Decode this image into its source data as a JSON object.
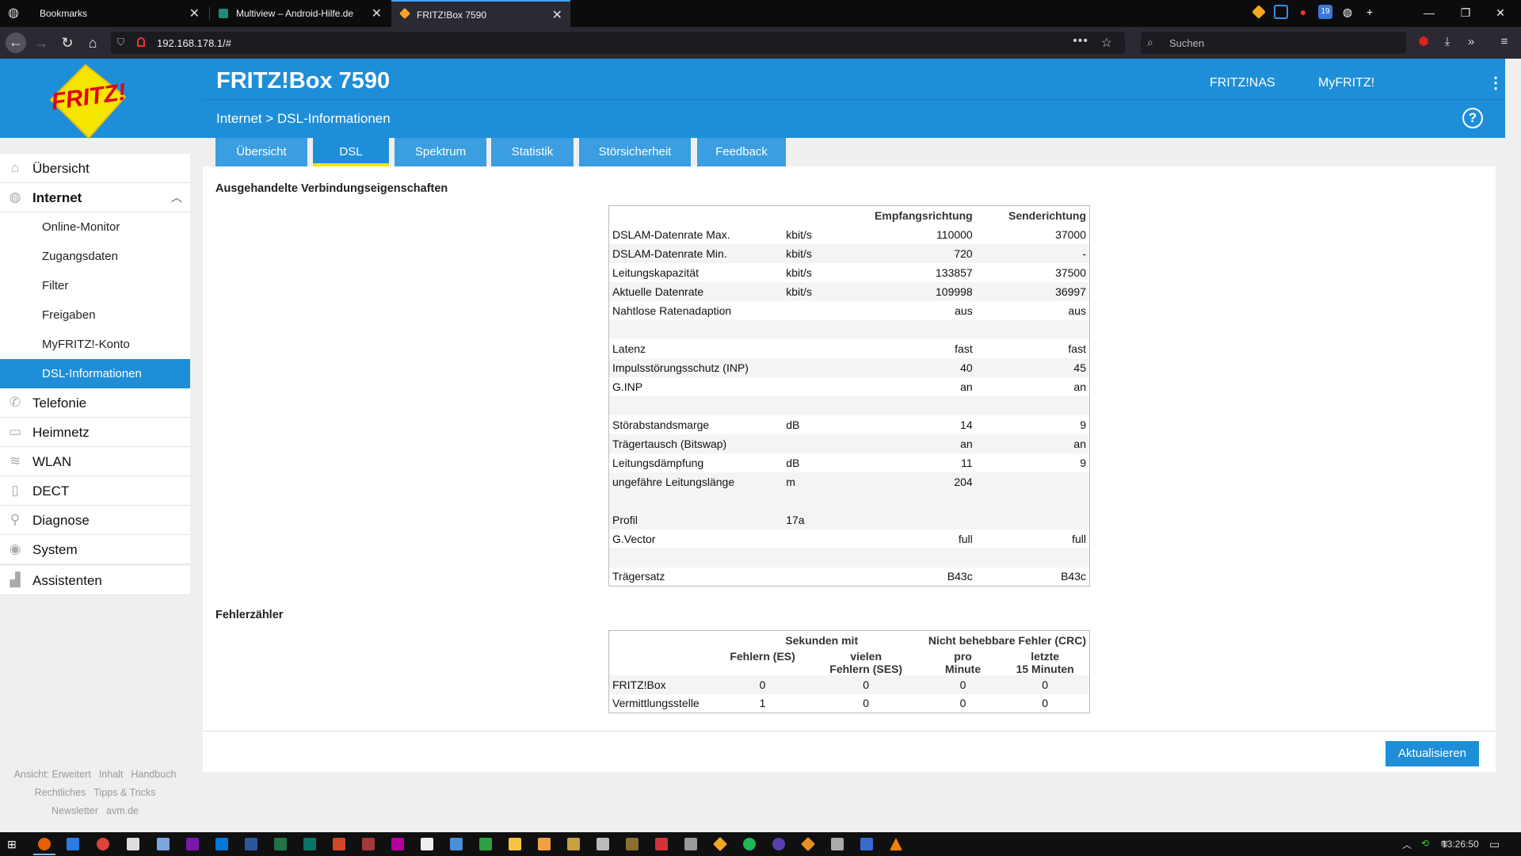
{
  "browser": {
    "tabs": [
      {
        "title": "Bookmarks",
        "active": false
      },
      {
        "title": "Multiview – Android-Hilfe.de",
        "active": false
      },
      {
        "title": "FRITZ!Box 7590",
        "active": true
      }
    ],
    "url": "192.168.178.1/#",
    "search_placeholder": "Suchen"
  },
  "header": {
    "logo_text": "FRITZ!",
    "title": "FRITZ!Box 7590",
    "links": [
      "FRITZ!NAS",
      "MyFRITZ!"
    ],
    "breadcrumb": "Internet > DSL-Informationen",
    "help": "?"
  },
  "tabs": [
    "Übersicht",
    "DSL",
    "Spektrum",
    "Statistik",
    "Störsicherheit",
    "Feedback"
  ],
  "active_tab": "DSL",
  "sidebar": {
    "items": [
      {
        "label": "Übersicht",
        "icon": "home-icon"
      },
      {
        "label": "Internet",
        "icon": "globe-icon",
        "expanded": true
      },
      {
        "label": "Telefonie",
        "icon": "phone-icon"
      },
      {
        "label": "Heimnetz",
        "icon": "network-icon"
      },
      {
        "label": "WLAN",
        "icon": "wifi-icon"
      },
      {
        "label": "DECT",
        "icon": "dect-icon"
      },
      {
        "label": "Diagnose",
        "icon": "diagnose-icon"
      },
      {
        "label": "System",
        "icon": "system-icon"
      },
      {
        "label": "Assistenten",
        "icon": "wizard-icon"
      }
    ],
    "subitems": [
      "Online-Monitor",
      "Zugangsdaten",
      "Filter",
      "Freigaben",
      "MyFRITZ!-Konto",
      "DSL-Informationen"
    ],
    "active_subitem": "DSL-Informationen",
    "footer": {
      "row1": [
        "Ansicht: Erweitert",
        "Inhalt",
        "Handbuch"
      ],
      "row2": [
        "Rechtliches",
        "Tipps & Tricks"
      ],
      "row3": [
        "Newsletter",
        "avm.de"
      ]
    }
  },
  "section1_title": "Ausgehandelte Verbindungseigenschaften",
  "dsl_table": {
    "headers": [
      "Empfangsrichtung",
      "Senderichtung"
    ],
    "rows": [
      {
        "label": "DSLAM-Datenrate Max.",
        "unit": "kbit/s",
        "rx": "110000",
        "tx": "37000"
      },
      {
        "label": "DSLAM-Datenrate Min.",
        "unit": "kbit/s",
        "rx": "720",
        "tx": "-"
      },
      {
        "label": "Leitungskapazität",
        "unit": "kbit/s",
        "rx": "133857",
        "tx": "37500"
      },
      {
        "label": "Aktuelle Datenrate",
        "unit": "kbit/s",
        "rx": "109998",
        "tx": "36997"
      },
      {
        "label": "Nahtlose Ratenadaption",
        "unit": "",
        "rx": "aus",
        "tx": "aus"
      },
      {
        "label": "",
        "unit": "",
        "rx": "",
        "tx": ""
      },
      {
        "label": "Latenz",
        "unit": "",
        "rx": "fast",
        "tx": "fast"
      },
      {
        "label": "Impulsstörungsschutz (INP)",
        "unit": "",
        "rx": "40",
        "tx": "45"
      },
      {
        "label": "G.INP",
        "unit": "",
        "rx": "an",
        "tx": "an"
      },
      {
        "label": "",
        "unit": "",
        "rx": "",
        "tx": ""
      },
      {
        "label": "Störabstandsmarge",
        "unit": "dB",
        "rx": "14",
        "tx": "9"
      },
      {
        "label": "Trägertausch (Bitswap)",
        "unit": "",
        "rx": "an",
        "tx": "an"
      },
      {
        "label": "Leitungsdämpfung",
        "unit": "dB",
        "rx": "11",
        "tx": "9"
      },
      {
        "label": "ungefähre Leitungslänge",
        "unit": "m",
        "rx": "204",
        "tx": ""
      },
      {
        "label": "",
        "unit": "",
        "rx": "",
        "tx": ""
      },
      {
        "label": "Profil",
        "unit": "17a",
        "rx": "",
        "tx": ""
      },
      {
        "label": "G.Vector",
        "unit": "",
        "rx": "full",
        "tx": "full"
      },
      {
        "label": "",
        "unit": "",
        "rx": "",
        "tx": ""
      },
      {
        "label": "Trägersatz",
        "unit": "",
        "rx": "B43c",
        "tx": "B43c"
      }
    ]
  },
  "section2_title": "Fehlerzähler",
  "err_table": {
    "group1": "Sekunden mit",
    "group2": "Nicht behebbare Fehler (CRC)",
    "cols": [
      {
        "line1": "Fehlern (ES)",
        "line2": ""
      },
      {
        "line1": "vielen",
        "line2": "Fehlern (SES)"
      },
      {
        "line1": "pro",
        "line2": "Minute"
      },
      {
        "line1": "letzte",
        "line2": "15 Minuten"
      }
    ],
    "rows": [
      {
        "label": "FRITZ!Box",
        "values": [
          "0",
          "0",
          "0",
          "0"
        ]
      },
      {
        "label": "Vermittlungsstelle",
        "values": [
          "1",
          "0",
          "0",
          "0"
        ]
      }
    ]
  },
  "refresh_button": "Aktualisieren",
  "clock": "13:26:50",
  "colors": {
    "fritz_blue": "#1f8ed8",
    "tab_highlight": "#f5e600",
    "logo_red": "#e2001a"
  }
}
